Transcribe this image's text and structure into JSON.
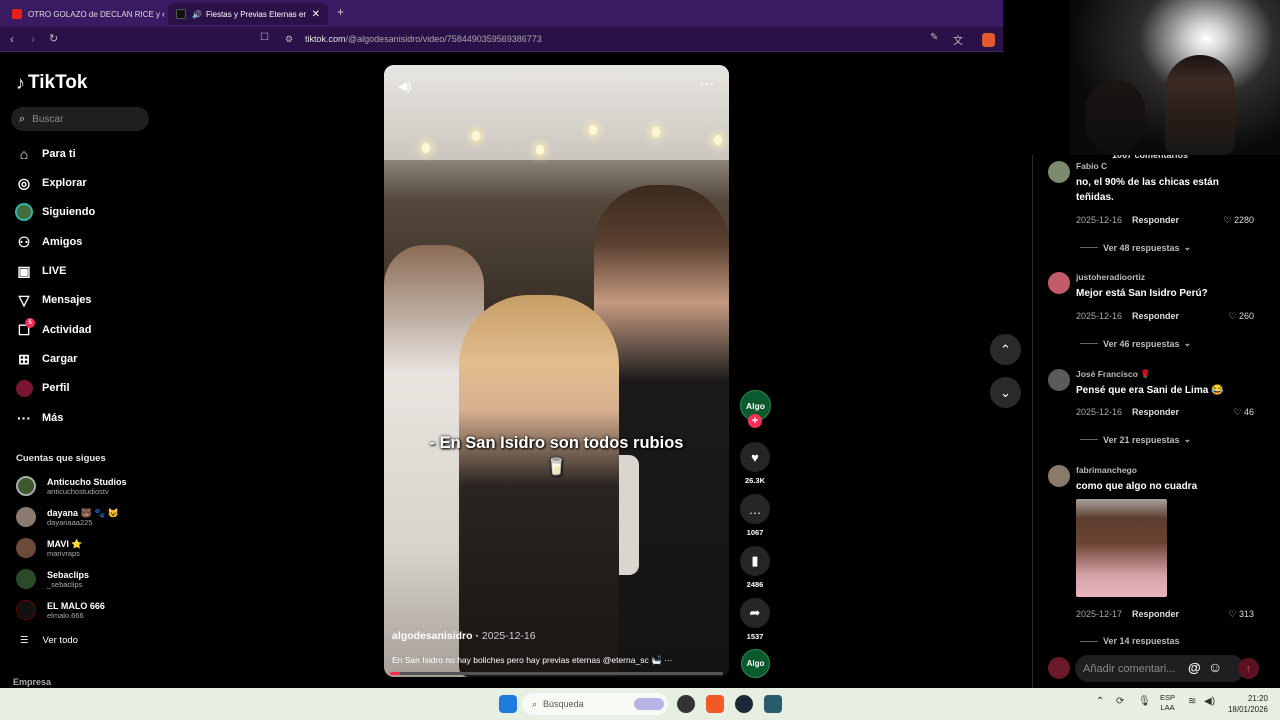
{
  "browser": {
    "tabs": [
      {
        "title": "OTRO GOLAZO de DECLAN RICE y el",
        "active": false
      },
      {
        "title": "Fiestas y Previas Eternas en S",
        "active": true
      }
    ],
    "url_host": "tiktok.com",
    "url_path": "/@algodesanisidro/video/7584490359569386773"
  },
  "sidebar": {
    "logo": "TikTok",
    "search_placeholder": "Buscar",
    "nav": [
      {
        "label": "Para ti",
        "icon": "home-icon"
      },
      {
        "label": "Explorar",
        "icon": "compass-icon"
      },
      {
        "label": "Siguiendo",
        "icon": "following-avatar-icon"
      },
      {
        "label": "Amigos",
        "icon": "friends-icon"
      },
      {
        "label": "LIVE",
        "icon": "live-icon"
      },
      {
        "label": "Mensajes",
        "icon": "messages-icon"
      },
      {
        "label": "Actividad",
        "icon": "activity-icon",
        "badge": "5"
      },
      {
        "label": "Cargar",
        "icon": "upload-icon"
      },
      {
        "label": "Perfil",
        "icon": "profile-icon"
      },
      {
        "label": "Más",
        "icon": "more-icon"
      }
    ],
    "following_title": "Cuentas que sigues",
    "accounts": [
      {
        "name": "Anticucho Studios",
        "handle": "anticuchostudiostv"
      },
      {
        "name": "dayana 🐻 🐾 😺",
        "handle": "dayanaaa225"
      },
      {
        "name": "MAVI ⭐",
        "handle": "marivraps"
      },
      {
        "name": "Sebaclips",
        "handle": "_sebaclips"
      },
      {
        "name": "EL MALO 666",
        "handle": "elmalo.666"
      }
    ],
    "see_all": "Ver todo",
    "footer": "Empresa"
  },
  "video": {
    "overlay_caption": "- En San Isidro son todos rubios 🥛",
    "author": "algodesanisidro",
    "date": "2025-12-16",
    "description": "En San Isidro no hay boliches pero hay previas eternas @eterna_sc 🛀 ···",
    "progress": 0.03
  },
  "actions": {
    "creator_initials": "Algo",
    "likes": "26.3K",
    "comments": "1067",
    "saves": "2486",
    "shares": "1537",
    "music_initials": "Algo"
  },
  "comments": {
    "title": "1067 comentarios",
    "items": [
      {
        "user": "Fabio C",
        "text": "no, el 90% de las chicas están teñidas.",
        "date": "2025-12-16",
        "reply": "Responder",
        "likes": "2280",
        "more": "Ver 48 respuestas"
      },
      {
        "user": "justoheradioortiz",
        "text": "Mejor está San Isidro Perú?",
        "date": "2025-12-16",
        "reply": "Responder",
        "likes": "260",
        "more": "Ver 46 respuestas"
      },
      {
        "user": "José Francisco 🌹",
        "text": "Pensé que era Sani de Lima 😂",
        "date": "2025-12-16",
        "reply": "Responder",
        "likes": "46",
        "more": "Ver 21 respuestas"
      },
      {
        "user": "fabrimanchego",
        "text": "como que algo no cuadra",
        "date": "2025-12-17",
        "reply": "Responder",
        "likes": "313",
        "more": "Ver 14 respuestas"
      }
    ],
    "input_placeholder": "Añadir comentari..."
  },
  "taskbar": {
    "search_placeholder": "Búsqueda",
    "lang_top": "ESP",
    "lang_bottom": "LAA",
    "time": "21:20",
    "date": "18/01/2026"
  },
  "colors": {
    "accent": "#fe2c55",
    "tabbar": "#3b1a64",
    "browser_bar": "#2a1148"
  }
}
